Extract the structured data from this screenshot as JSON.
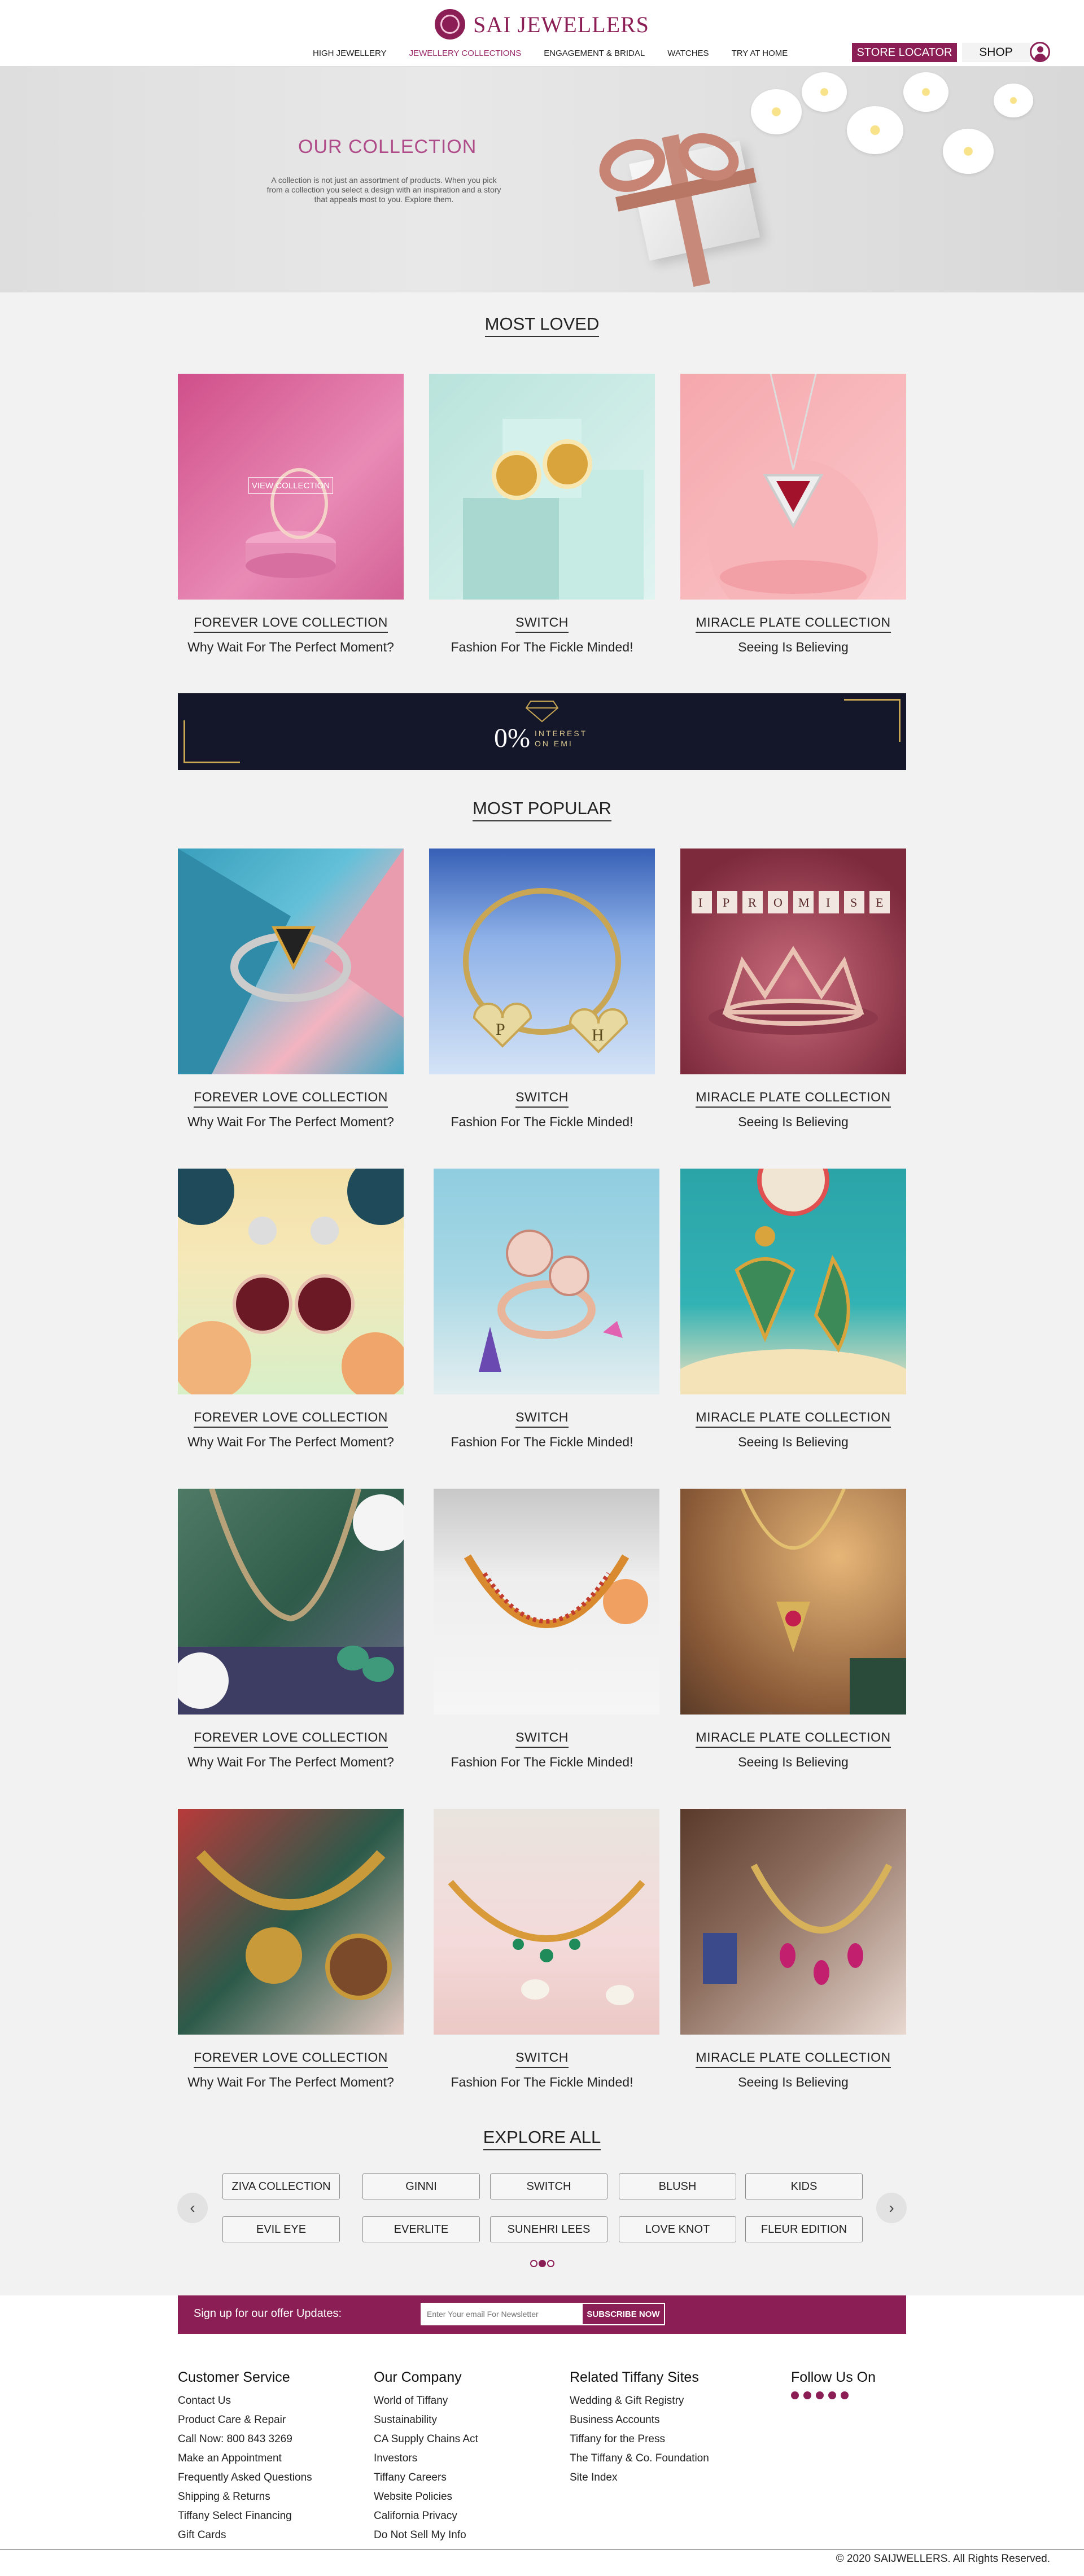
{
  "header": {
    "brand": "SAI JEWELLERS",
    "nav": [
      "HIGH JEWELLERY",
      "JEWELLERY COLLECTIONS",
      "ENGAGEMENT & BRIDAL",
      "WATCHES",
      "TRY AT HOME"
    ],
    "active_nav": "JEWELLERY COLLECTIONS",
    "store_locator": "STORE LOCATOR",
    "shop": "SHOP"
  },
  "hero": {
    "title": "OUR COLLECTION",
    "description": "A collection is not just an assortment of products. When you pick from a collection you select a design with an inspiration and a story that appeals most to you. Explore them."
  },
  "most_loved": {
    "title": "MOST LOVED",
    "view_collection": "VIEW COLLECTION",
    "cards": [
      {
        "title": "FOREVER LOVE COLLECTION",
        "subtitle": "Why Wait For The Perfect Moment?"
      },
      {
        "title": "SWITCH",
        "subtitle": "Fashion For The Fickle Minded!"
      },
      {
        "title": "MIRACLE PLATE COLLECTION",
        "subtitle": "Seeing Is Believing"
      }
    ]
  },
  "emi_banner": {
    "big": "0%",
    "line1": "INTEREST",
    "line2": "ON EMI"
  },
  "most_popular": {
    "title": "MOST POPULAR",
    "rows": [
      [
        {
          "title": "FOREVER LOVE COLLECTION",
          "subtitle": "Why Wait For The Perfect Moment?"
        },
        {
          "title": "SWITCH",
          "subtitle": "Fashion For The Fickle Minded!"
        },
        {
          "title": "MIRACLE PLATE COLLECTION",
          "subtitle": "Seeing Is Believing"
        }
      ],
      [
        {
          "title": "FOREVER LOVE COLLECTION",
          "subtitle": "Why Wait For The Perfect Moment?"
        },
        {
          "title": "SWITCH",
          "subtitle": "Fashion For The Fickle Minded!"
        },
        {
          "title": "MIRACLE PLATE COLLECTION",
          "subtitle": "Seeing Is Believing"
        }
      ],
      [
        {
          "title": "FOREVER LOVE COLLECTION",
          "subtitle": "Why Wait For The Perfect Moment?"
        },
        {
          "title": "SWITCH",
          "subtitle": "Fashion For The Fickle Minded!"
        },
        {
          "title": "MIRACLE PLATE COLLECTION",
          "subtitle": "Seeing Is Believing"
        }
      ],
      [
        {
          "title": "FOREVER LOVE COLLECTION",
          "subtitle": "Why Wait For The Perfect Moment?"
        },
        {
          "title": "SWITCH",
          "subtitle": "Fashion For The Fickle Minded!"
        },
        {
          "title": "MIRACLE PLATE COLLECTION",
          "subtitle": "Seeing Is Believing"
        }
      ]
    ],
    "promise_letters": [
      "I",
      "P",
      "R",
      "O",
      "M",
      "I",
      "S",
      "E"
    ],
    "pendant_letters": [
      "P",
      "H"
    ]
  },
  "explore": {
    "title": "EXPLORE ALL",
    "row1": [
      "ZIVA COLLECTION",
      "GINNI",
      "SWITCH",
      "BLUSH",
      "KIDS"
    ],
    "row2": [
      "EVIL EYE",
      "EVERLITE",
      "SUNEHRI LEES",
      "LOVE KNOT",
      "FLEUR EDITION"
    ],
    "prev": "‹",
    "next": "›",
    "active_dot": 1
  },
  "newsletter": {
    "label": "Sign up for our offer Updates:",
    "placeholder": "Enter Your email For Newsletter",
    "button": "SUBSCRIBE NOW"
  },
  "footer": {
    "customer_service": {
      "title": "Customer Service",
      "links": [
        "Contact Us",
        "Product Care & Repair",
        "Call Now: 800 843 3269",
        "Make an Appointment",
        "Frequently Asked Questions",
        "Shipping & Returns",
        "Tiffany Select Financing",
        "Gift Cards"
      ]
    },
    "our_company": {
      "title": "Our Company",
      "links": [
        "World of Tiffany",
        "Sustainability",
        "CA Supply Chains Act",
        "Investors",
        "Tiffany Careers",
        "Website Policies",
        "California Privacy",
        "Do Not Sell My Info"
      ]
    },
    "related": {
      "title": "Related Tiffany Sites",
      "links": [
        "Wedding & Gift Registry",
        "Business Accounts",
        "Tiffany for the Press",
        "The Tiffany & Co. Foundation",
        "Site Index"
      ]
    },
    "follow": {
      "title": "Follow Us On",
      "icons": [
        "facebook-icon",
        "youtube-icon",
        "twitter-icon",
        "pinterest-icon",
        "instagram-icon"
      ]
    },
    "copyright": "© 2020 SAIJWELLERS. All Rights Reserved."
  },
  "colors": {
    "brand": "#8b1e55",
    "hero_title": "#b04b8a",
    "background": "#f2f2f2"
  }
}
